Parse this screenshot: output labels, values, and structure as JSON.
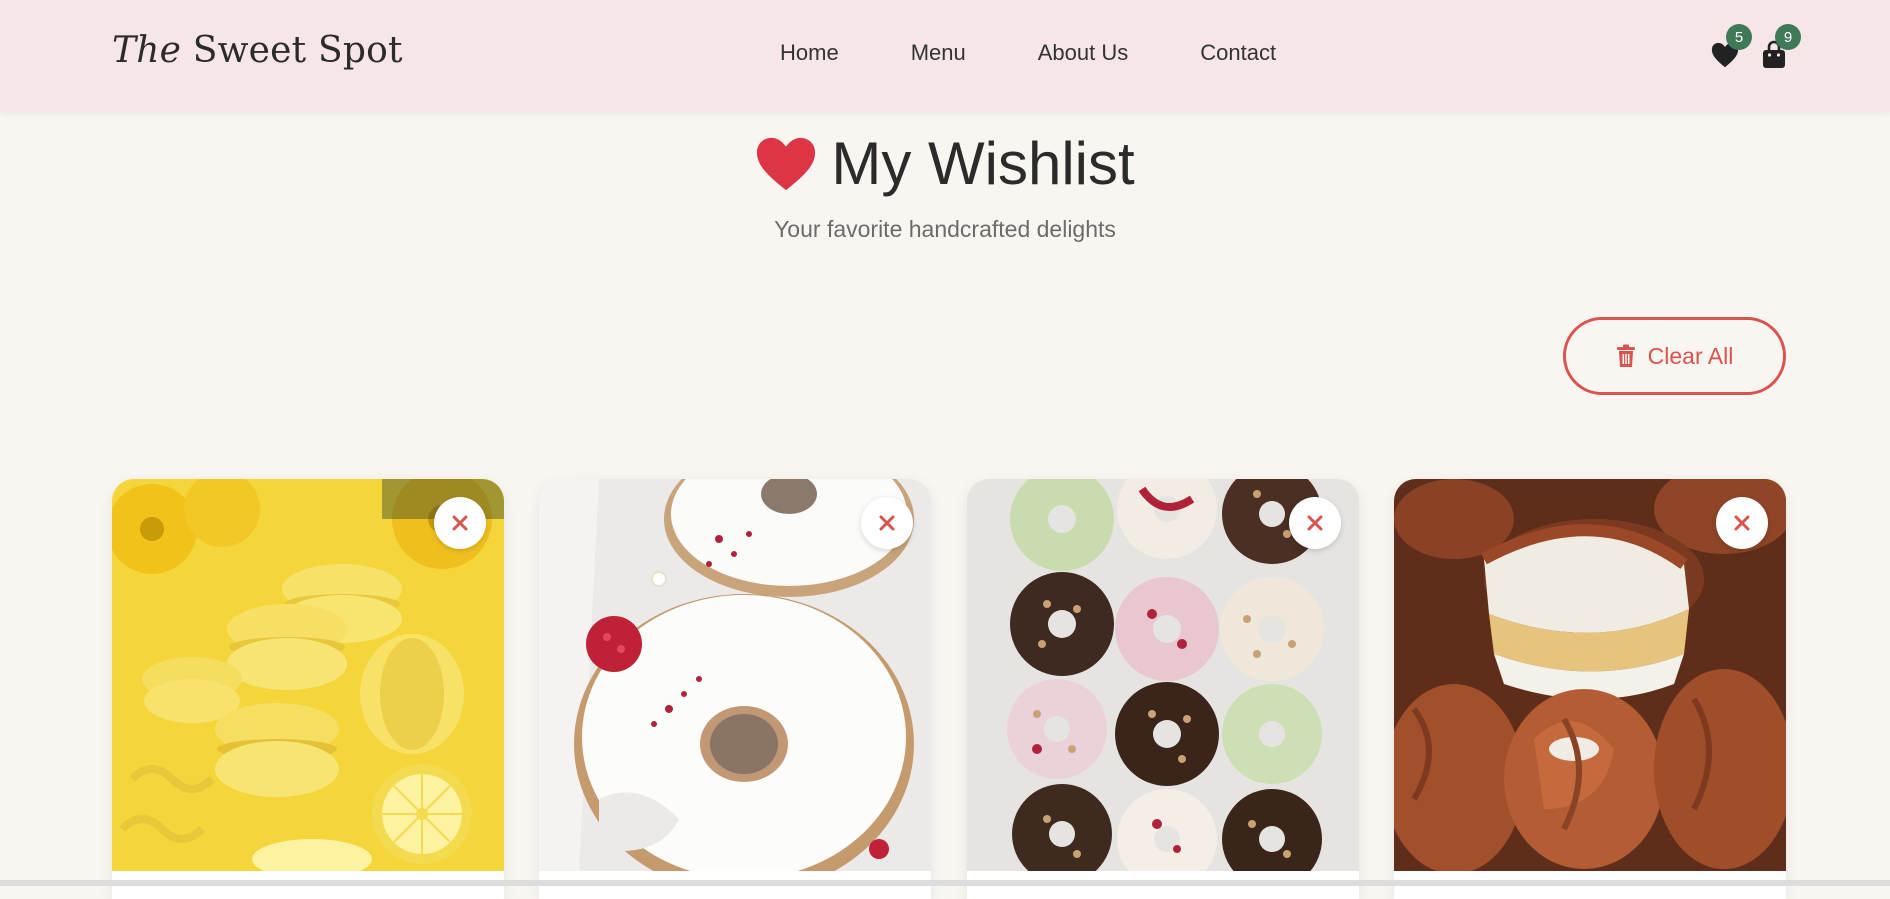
{
  "brand": {
    "italic": "The",
    "rest": "Sweet Spot"
  },
  "nav": {
    "links": [
      "Home",
      "Menu",
      "About Us",
      "Contact"
    ]
  },
  "header_icons": {
    "wishlist_count": "5",
    "cart_count": "9"
  },
  "hero": {
    "title": "My Wishlist",
    "subtitle": "Your favorite handcrafted delights"
  },
  "actions": {
    "clear_all": "Clear All"
  },
  "colors": {
    "accent_red": "#d9534f",
    "heart_red": "#dc3545",
    "badge_green": "#3f7a57",
    "header_bg": "#f6e6e8",
    "page_bg": "#f9f6f2"
  },
  "items": [
    {
      "image": "lemon-macarons"
    },
    {
      "image": "glazed-donuts-raspberry"
    },
    {
      "image": "assorted-donuts-grid"
    },
    {
      "image": "tiramisu"
    }
  ]
}
